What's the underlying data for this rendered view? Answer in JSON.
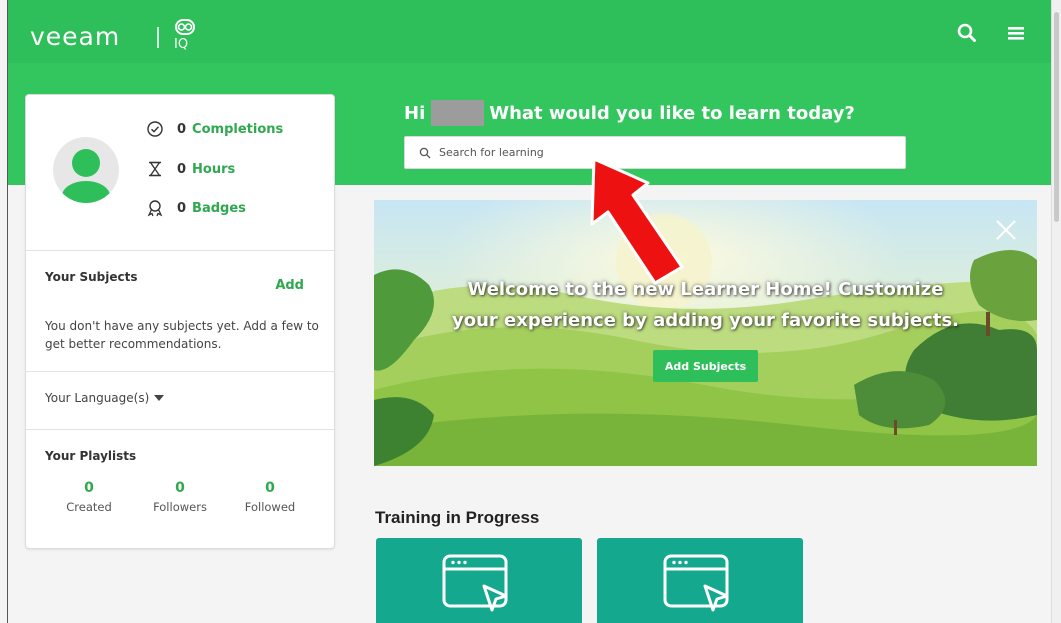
{
  "topbar": {
    "logo_text": "veeam",
    "logo_sub": "IQ",
    "search_icon": "search-icon",
    "menu_icon": "hamburger-menu-icon",
    "color": "#2fbf5a"
  },
  "profile": {
    "stats": [
      {
        "icon": "check-circle-icon",
        "value": "0",
        "label": "Completions"
      },
      {
        "icon": "hourglass-icon",
        "value": "0",
        "label": "Hours"
      },
      {
        "icon": "badge-ribbon-icon",
        "value": "0",
        "label": "Badges"
      }
    ],
    "subjects": {
      "title": "Your Subjects",
      "add_label": "Add",
      "empty_message": "You don't have any subjects yet. Add a few to get better recommendations."
    },
    "language_label": "Your Language(s)",
    "playlists": {
      "title": "Your Playlists",
      "stats": [
        {
          "value": "0",
          "label": "Created"
        },
        {
          "value": "0",
          "label": "Followers"
        },
        {
          "value": "0",
          "label": "Followed"
        }
      ]
    }
  },
  "hero": {
    "greeting_prefix": "Hi",
    "greeting_question": "What would you like to learn today?",
    "search_placeholder": "Search for learning"
  },
  "banner": {
    "line1": "Welcome to the new Learner Home! Customize",
    "line2": "your experience by adding your favorite subjects.",
    "button_label": "Add Subjects"
  },
  "training": {
    "title": "Training in Progress",
    "cards": [
      {
        "icon": "browser-cursor-icon"
      },
      {
        "icon": "browser-cursor-icon"
      }
    ]
  },
  "annotation": {
    "arrow_color": "#ee1111"
  }
}
